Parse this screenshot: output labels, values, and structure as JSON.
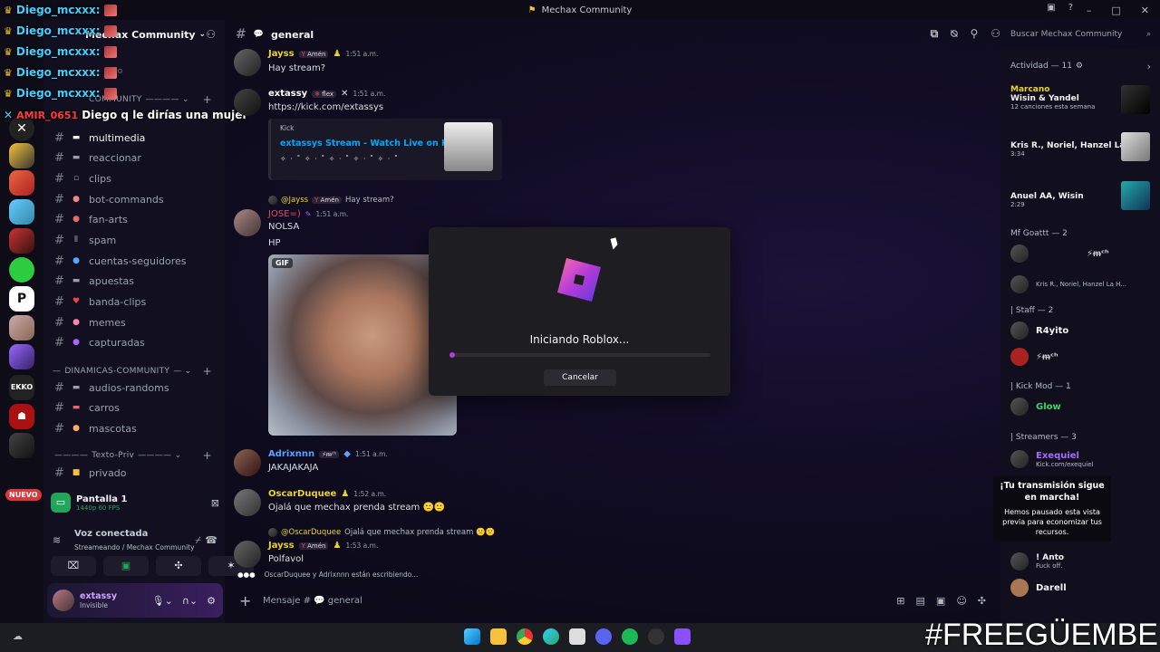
{
  "window": {
    "title": "Mechax Community"
  },
  "overlay_chat": [
    {
      "name": "Diego_mcxxx:",
      "message": ""
    },
    {
      "name": "Diego_mcxxx:",
      "message": ""
    },
    {
      "name": "Diego_mcxxx:",
      "message": ""
    },
    {
      "name": "Diego_mcxxx:",
      "message": ""
    },
    {
      "name": "Diego_mcxxx:",
      "message": ""
    },
    {
      "name": "AMIR_0651",
      "message": "Diego q le dirías una mujer"
    }
  ],
  "sidebar": {
    "server_name": "Mechax Community",
    "faded_items": [
      "ok",
      "ario",
      "COMMUNITY"
    ],
    "channels": [
      {
        "name": "multimedia"
      },
      {
        "name": "reaccionar"
      },
      {
        "name": "clips"
      },
      {
        "name": "bot-commands"
      },
      {
        "name": "fan-arts"
      },
      {
        "name": "spam"
      },
      {
        "name": "cuentas-seguidores"
      },
      {
        "name": "apuestas"
      },
      {
        "name": "banda-clips"
      },
      {
        "name": "memes"
      },
      {
        "name": "capturadas"
      }
    ],
    "category_dinamicas": "DINAMICAS-COMMUNITY",
    "channels2": [
      {
        "name": "audios-randoms"
      },
      {
        "name": "carros"
      },
      {
        "name": "mascotas"
      }
    ],
    "category_texto": "Texto-Priv",
    "channels3": [
      {
        "name": "privado"
      }
    ],
    "new_badge": "NUEVO"
  },
  "stream": {
    "title": "Pantalla 1",
    "quality": "1440p 60 FPS"
  },
  "voice": {
    "title": "Voz conectada",
    "subtitle": "Streameando / Mechax Community"
  },
  "user": {
    "name": "extassy",
    "status": "Invisible"
  },
  "chat": {
    "channel": "general",
    "messages": [
      {
        "user": "Jayss",
        "role": "Amén",
        "time": "1:51 a.m.",
        "text": "Hay stream?"
      },
      {
        "user": "extassy",
        "role": "flex",
        "time": "1:51 a.m.",
        "text": "https://kick.com/extassys"
      },
      {
        "reply_user": "@Jayss",
        "reply_role": "Amén",
        "reply_text": "Hay stream?",
        "user": "JOSE=)",
        "time": "1:51 a.m.",
        "text": "NOLSA",
        "text2": "HP"
      },
      {
        "user": "Adrixnnn",
        "role": "",
        "time": "1:51 a.m.",
        "text": "JAKAJAKAJA"
      },
      {
        "user": "OscarDuquee",
        "role": "",
        "time": "1:52 a.m.",
        "text": "Ojalá que mechax prenda stream 🙁🙁"
      },
      {
        "reply_user": "@OscarDuquee",
        "reply_text": "Ojalá que mechax prenda stream 🙁🙁",
        "user": "Jayss",
        "role": "Amén",
        "time": "1:53 a.m.",
        "text": "Polfavol"
      }
    ],
    "embed": {
      "provider": "Kick",
      "title": "extassys Stream - Watch Live on Kick",
      "desc": "✧ · ˚ ✧ · ˚ ✧ · ˚ ✧ · ˚ ✧ · ˚"
    },
    "gif_tag": "GIF",
    "typing_text": "OscarDuquee y Adrixnnn están escribiendo...",
    "composer_placeholder": "Mensaje #",
    "composer_channel": "general"
  },
  "search": {
    "placeholder": "Buscar Mechax Community"
  },
  "modal": {
    "title": "Iniciando Roblox...",
    "cancel": "Cancelar",
    "progress": 0.02
  },
  "members": {
    "activity_header": "Actividad — 11",
    "activities": [
      {
        "label": "Marcano",
        "title": "Wisin & Yandel",
        "sub": "12 canciones esta semana"
      },
      {
        "title": "Kris R., Noriel, Hanzel La H...",
        "sub": "3:34"
      },
      {
        "title": "Anuel AA, Wisin",
        "sub": "2:29"
      }
    ],
    "group_goattt": "Mf Goattt — 2",
    "goattt_sub": "Kris R., Noriel, Hanzel La H...",
    "group_staff": "| Staff — 2",
    "staff_name": "R4yito",
    "group_kickmod": "| Kick Mod — 1",
    "kickmod_name": "Glow",
    "group_streamers": "| Streamers — 3",
    "streamer_name": "Exequiel",
    "streamer_sub": "Kick.com/exequiel",
    "anto_name": "! Anto",
    "anto_sub": "Fuck off.",
    "darell_name": "Darell"
  },
  "notice": {
    "title": "¡Tu transmisión sigue en marcha!",
    "body": "Hemos pausado esta vista previa para economizar tus recursos."
  },
  "watermark": "#FREEGÜEMBE",
  "colors": {
    "accent": "#b43bd6",
    "overlay_name": "#3fd0ff",
    "jayss": "#e9d32a",
    "oscar": "#e9d32a",
    "jose": "#e0466a",
    "adrix": "#5aa3ff",
    "exequiel": "#a56bff",
    "glow": "#3ad46b"
  }
}
